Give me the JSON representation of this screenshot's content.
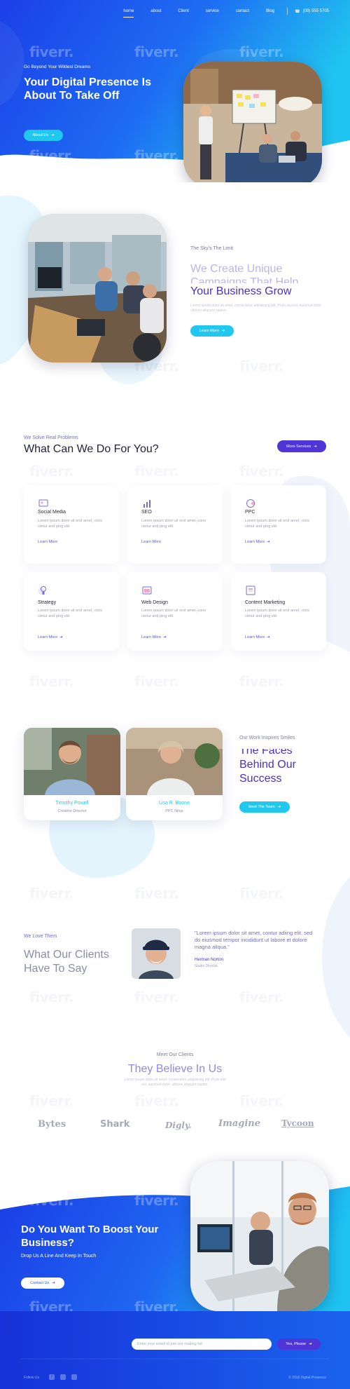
{
  "nav": {
    "items": [
      "home",
      "about",
      "Client",
      "service",
      "contact",
      "Blog"
    ],
    "active": "home",
    "phone": "(09) 555 5705"
  },
  "watermark": "fiverr.",
  "hero": {
    "eyebrow": "Go Beyond Your Wildest Dreams",
    "title": "Your Digital Presence Is About To Take Off",
    "cta": "About Us"
  },
  "about": {
    "eyebrow": "The Sky's The Limit",
    "title_light": "We Create Unique Campaigns That Help",
    "title_dark": "Your Business Grow",
    "text": "Lorem ipsum dolor sit amet, consectetur adipisicing elit, Proin nisi est, euismod dolor, ultrices aliquam sapien.",
    "cta": "Learn More"
  },
  "services": {
    "eyebrow": "We Solve Real Problems",
    "title": "What Can We Do For You?",
    "cta": "More Services",
    "items": [
      {
        "icon": "social-media-icon",
        "title": "Social Media",
        "text": "Lorem ipsum dolor sit orot amet, cons ctetur and ping elit.",
        "link": "Learn More"
      },
      {
        "icon": "seo-chart-icon",
        "title": "SEO",
        "text": "Lorem ipsum dolor sit orot amet, cons ctetur and ping elit.",
        "link": "Learn More"
      },
      {
        "icon": "ppc-icon",
        "title": "PPC",
        "text": "Lorem ipsum dolor sit orot amet, cons ctetur and ping elit.",
        "link": "Learn More"
      },
      {
        "icon": "lightbulb-icon",
        "title": "Strategy",
        "text": "Lorem ipsum dolor sit orot amet, cons ctetur and ping elit.",
        "link": "Learn More"
      },
      {
        "icon": "web-design-icon",
        "title": "Web Design",
        "text": "Lorem ipsum dolor sit orot amet, cons ctetur and ping elit.",
        "link": "Learn More"
      },
      {
        "icon": "content-marketing-icon",
        "title": "Content Marketing",
        "text": "Lorem ipsum dolor sit orot amet, cons ctetur and ping elit.",
        "link": "Learn More"
      }
    ]
  },
  "team": {
    "eyebrow": "Our Work Inspires Smiles",
    "title": "The Faces Behind Our Success",
    "cta": "Meet The Team",
    "members": [
      {
        "name": "Timothy Powell",
        "role": "Creative Director"
      },
      {
        "name": "Lisa R. Boone",
        "role": "PPC Ninja"
      }
    ]
  },
  "testimonial": {
    "eyebrow": "We Love Them",
    "title": "What Our Clients Have To Say",
    "quote": "\"Lorem ipsum dolor sit amet, contur adiing elit, sed do eiusmod tempor incididunt ut labore et dolore magna aliqua.\"",
    "author": "Herman Norton",
    "author_role": "Studio Director"
  },
  "clients": {
    "eyebrow": "Meet Our Clients",
    "title": "They Believe In Us",
    "text": "Lorem ipsum dolor sit amet, consectetur adipisicing elit. Proin nisi est, euismod dolor, ultrices aliquam sapien.",
    "logos": [
      "Bytes",
      "Shark",
      "Digly.",
      "Imagine",
      "Tycoon"
    ]
  },
  "cta": {
    "title": "Do You Want To Boost Your Business?",
    "subtitle": "Drop Us A Line And Keep In Touch",
    "button": "Contact Us"
  },
  "footer": {
    "email_placeholder": "Enter your email to join our mailing list",
    "subscribe": "Yes, Please",
    "follow": "Follow Us",
    "copyright": "© 2018 Digital Presence"
  },
  "colors": {
    "primary_blue": "#1f5cf0",
    "cyan": "#1ecbef",
    "purple": "#5b3fd6",
    "text_dark": "#2a2a3c"
  }
}
